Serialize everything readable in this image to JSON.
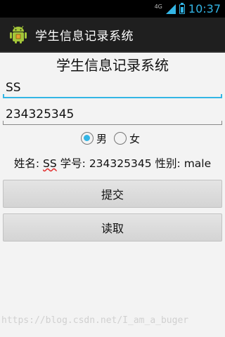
{
  "status_bar": {
    "network": "4G",
    "time": "10:37"
  },
  "action_bar": {
    "title": "学生信息记录系统",
    "icon": "android-icon"
  },
  "form": {
    "heading": "学生信息记录系统",
    "name_value": "SS",
    "id_value": "234325345",
    "gender_options": [
      {
        "label": "男",
        "checked": true
      },
      {
        "label": "女",
        "checked": false
      }
    ]
  },
  "info": {
    "name_label": "姓名:",
    "name_value": "SS",
    "id_label": "学号:",
    "id_value": "234325345",
    "gender_label": "性别:",
    "gender_value": "male"
  },
  "buttons": {
    "submit": "提交",
    "read": "读取"
  },
  "watermark": "https://blog.csdn.net/I_am_a_buger",
  "colors": {
    "accent": "#33b5e5",
    "action_bar": "#1f1f1f",
    "background": "#f3f3f3"
  }
}
